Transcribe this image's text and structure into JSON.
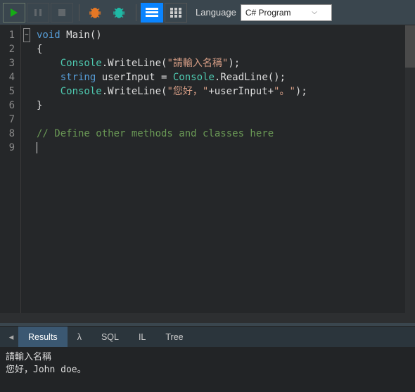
{
  "toolbar": {
    "play": "Run",
    "pause": "Pause",
    "stop": "Stop",
    "bug1": "Debug",
    "bug2": "Debug Alt",
    "viewList": "List view",
    "viewGrid": "Grid view",
    "languageLabel": "Language",
    "languageValue": "C# Program"
  },
  "gutter": [
    "1",
    "2",
    "3",
    "4",
    "5",
    "6",
    "7",
    "8",
    "9"
  ],
  "code": {
    "l1": {
      "a": "void",
      "b": " Main()"
    },
    "l2": "{",
    "l3": {
      "a": "Console",
      "b": ".WriteLine(",
      "c": "\"請輸入名稱\"",
      "d": ");"
    },
    "l4": {
      "a": "string",
      "b": " userInput = ",
      "c": "Console",
      "d": ".ReadLine();"
    },
    "l5": {
      "a": "Console",
      "b": ".WriteLine(",
      "c": "\"您好，\"",
      "d": "+userInput+",
      "e": "\"。\"",
      "f": ");"
    },
    "l6": "}",
    "l8": "// Define other methods and classes here"
  },
  "tabs": {
    "results": "Results",
    "lambda": "λ",
    "sql": "SQL",
    "il": "IL",
    "tree": "Tree"
  },
  "output": {
    "line1": "請輸入名稱",
    "line2": "您好，John doe。"
  }
}
